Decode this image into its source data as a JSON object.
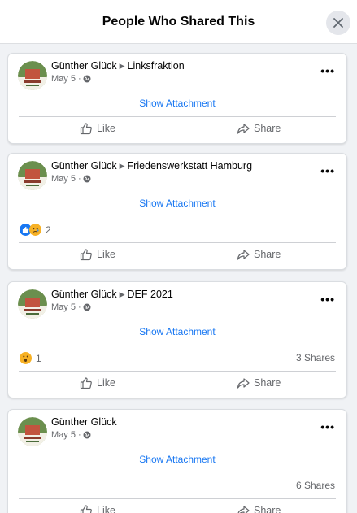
{
  "dialog": {
    "title": "People Who Shared This",
    "close_icon": "close-icon"
  },
  "colors": {
    "link": "#1877f2",
    "muted": "#65676b",
    "header_bg": "#ffffff",
    "page_bg": "#f0f2f5"
  },
  "posts": [
    {
      "author": "Günther Glück",
      "target": "Linksfraktion",
      "date": "May 5 ·",
      "attachment_label": "Show Attachment",
      "like_label": "Like",
      "share_label": "Share"
    },
    {
      "author": "Günther Glück",
      "target": "Friedenswerkstatt Hamburg",
      "date": "May 5 ·",
      "attachment_label": "Show Attachment",
      "reaction_count": "2",
      "like_label": "Like",
      "share_label": "Share"
    },
    {
      "author": "Günther Glück",
      "target": "DEF 2021",
      "date": "May 5 ·",
      "attachment_label": "Show Attachment",
      "reaction_count": "1",
      "shares": "3 Shares",
      "like_label": "Like",
      "share_label": "Share"
    },
    {
      "author": "Günther Glück",
      "date": "May 5 ·",
      "attachment_label": "Show Attachment",
      "shares": "6 Shares",
      "like_label": "Like",
      "share_label": "Share"
    }
  ]
}
